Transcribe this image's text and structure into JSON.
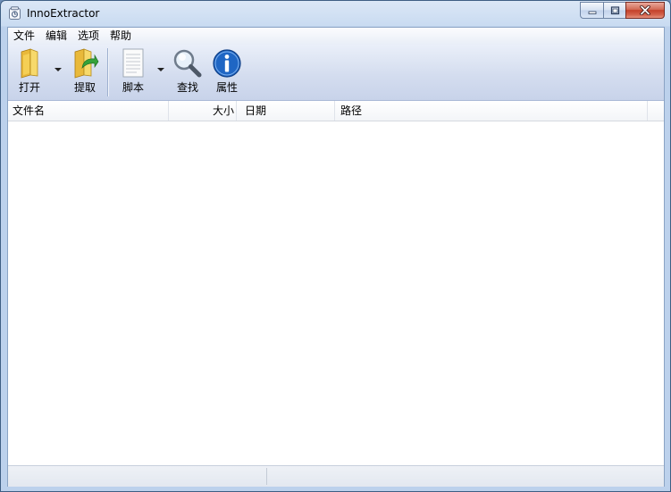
{
  "window": {
    "title": "InnoExtractor"
  },
  "menu": [
    {
      "label": "文件"
    },
    {
      "label": "编辑"
    },
    {
      "label": "选项"
    },
    {
      "label": "帮助"
    }
  ],
  "toolbar": {
    "open": {
      "label": "打开",
      "icon": "folder-icon"
    },
    "extract": {
      "label": "提取",
      "icon": "folder-extract-icon"
    },
    "script": {
      "label": "脚本",
      "icon": "document-icon"
    },
    "find": {
      "label": "查找",
      "icon": "magnifier-icon"
    },
    "properties": {
      "label": "属性",
      "icon": "info-icon"
    }
  },
  "columns": [
    {
      "label": "文件名"
    },
    {
      "label": "大小"
    },
    {
      "label": "日期"
    },
    {
      "label": "路径"
    }
  ],
  "status": {
    "pane1": "",
    "pane2": ""
  },
  "colors": {
    "accent": "#1f66c4",
    "close": "#c4402a",
    "folder": "#f2c94c"
  }
}
